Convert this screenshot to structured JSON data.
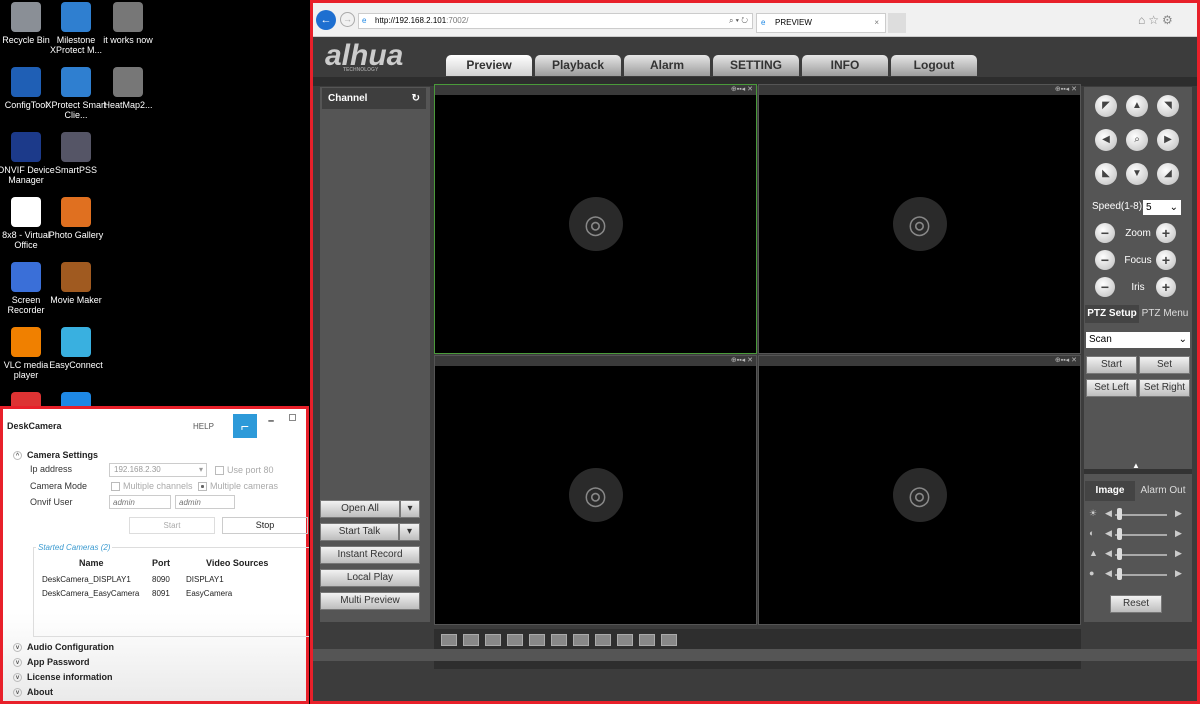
{
  "desktop": {
    "icons": [
      {
        "label": "Recycle Bin",
        "color": "#8a8f96"
      },
      {
        "label": "Milestone XProtect M...",
        "color": "#2f7fd0"
      },
      {
        "label": "it works now",
        "color": "#777"
      },
      {
        "label": "ConfigTool",
        "color": "#1f5fb5"
      },
      {
        "label": "XProtect Smart Clie...",
        "color": "#2f7fd0"
      },
      {
        "label": "HeatMap2...",
        "color": "#777"
      },
      {
        "label": "ONVIF Device Manager",
        "color": "#1c3a8a"
      },
      {
        "label": "SmartPSS",
        "color": "#556"
      },
      {
        "label": "8x8 - Virtual Office",
        "color": "#fff"
      },
      {
        "label": "Photo Gallery",
        "color": "#e07020"
      },
      {
        "label": "Screen Recorder",
        "color": "#3a6fd8"
      },
      {
        "label": "Movie Maker",
        "color": "#a05a20"
      },
      {
        "label": "VLC media player",
        "color": "#f08000"
      },
      {
        "label": "EasyConnect",
        "color": "#39b0e0"
      },
      {
        "label": "",
        "color": "#d33"
      },
      {
        "label": "",
        "color": "#1e88e5"
      }
    ]
  },
  "deskcamera": {
    "title": "DeskCamera",
    "help": "HELP",
    "sections": {
      "camera_settings": "Camera Settings",
      "audio": "Audio Configuration",
      "password": "App Password",
      "license": "License information",
      "about": "About"
    },
    "ip_label": "Ip address",
    "ip_value": "192.168.2.30",
    "use_port": "Use port 80",
    "mode_label": "Camera Mode",
    "multi_channels": "Multiple channels",
    "multi_cameras": "Multiple cameras",
    "onvif_label": "Onvif User",
    "onvif_user_placeholder": "admin",
    "onvif_pass_placeholder": "admin",
    "start": "Start",
    "stop": "Stop",
    "started_title": "Started Cameras (2)",
    "columns": [
      "Name",
      "Port",
      "Video Sources"
    ],
    "rows": [
      [
        "DeskCamera_DISPLAY1",
        "8090",
        "DISPLAY1"
      ],
      [
        "DeskCamera_EasyCamera",
        "8091",
        "EasyCamera"
      ]
    ]
  },
  "browser": {
    "url_host": "http://192.168.2.101",
    "url_port": ":7002/",
    "tab_title": "PREVIEW"
  },
  "dahua": {
    "logo": "alhua",
    "logo_sub": "TECHNOLOGY",
    "tabs": [
      "Preview",
      "Playback",
      "Alarm",
      "SETTING",
      "INFO",
      "Logout"
    ],
    "channel": "Channel",
    "buttons": {
      "open_all": "Open All",
      "start_talk": "Start Talk",
      "instant_record": "Instant Record",
      "local_play": "Local Play",
      "multi_preview": "Multi Preview"
    },
    "cell_icons": "⊕▪▪◂ ✕",
    "ptz": {
      "speed_label": "Speed(1-8):",
      "speed": "5",
      "zoom": "Zoom",
      "focus": "Focus",
      "iris": "Iris",
      "tab_setup": "PTZ Setup",
      "tab_menu": "PTZ Menu",
      "mode": "Scan",
      "start": "Start",
      "set": "Set",
      "set_left": "Set Left",
      "set_right": "Set Right"
    },
    "image": {
      "tab_image": "Image",
      "tab_alarm": "Alarm Out",
      "reset": "Reset"
    }
  }
}
